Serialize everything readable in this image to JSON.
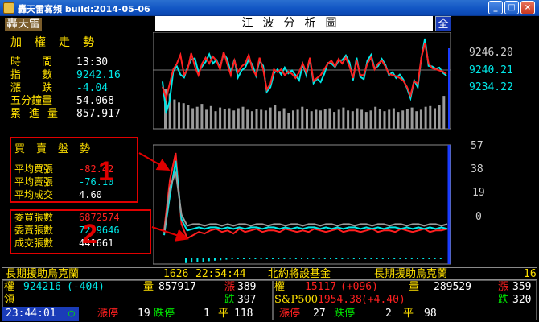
{
  "window": {
    "title": "轟天雷寫頻 build:2014-05-06",
    "btn_minimize": "_",
    "btn_maximize": "□",
    "btn_close": "×"
  },
  "header": {
    "brand": "轟天雷",
    "chart_title": "江波分析圖",
    "corner_button": "全"
  },
  "index_panel": {
    "heading": "加權走勢",
    "rows": [
      {
        "label": "時　　間",
        "value": "13:30",
        "color": "#ffffff"
      },
      {
        "label": "指　　數",
        "value": "9242.16",
        "color": "#00e8e8"
      },
      {
        "label": "漲　　跌",
        "value": "-4.04",
        "color": "#00e8e8"
      },
      {
        "label": "五分鐘量",
        "value": "54.068",
        "color": "#ffffff"
      },
      {
        "label": "累進量",
        "value": "857.917",
        "color": "#ffffff"
      }
    ]
  },
  "order_panel": {
    "heading": "買賣盤勢",
    "rows": [
      {
        "label": "平均買張",
        "value": "-82.42",
        "color": "#ff2020"
      },
      {
        "label": "平均賣張",
        "value": "-76.10",
        "color": "#00e8e8"
      },
      {
        "label": "平均成交",
        "value": "4.60",
        "color": "#ffffff"
      }
    ],
    "marker": "1"
  },
  "volume_panel": {
    "rows": [
      {
        "label": "委買張數",
        "value": "6872574",
        "color": "#ff2020"
      },
      {
        "label": "委賣張數",
        "value": "7229646",
        "color": "#00e8e8"
      },
      {
        "label": "成交張數",
        "value": "441661",
        "color": "#ffffff"
      }
    ],
    "marker": "2"
  },
  "price_axis": {
    "labels": [
      "9246.20",
      "9240.21",
      "9234.22"
    ]
  },
  "order_axis": {
    "labels": [
      "57",
      "38",
      "19",
      "0"
    ]
  },
  "ticker": {
    "items": [
      "長期援助烏克蘭",
      "1626",
      "22:54:44",
      "北約將設基金",
      "長期援助烏克蘭",
      "16"
    ]
  },
  "market_row1": {
    "left_label": "權",
    "left_value": "924216",
    "left_change": "(-404)",
    "vol_label": "量",
    "vol_value": "857917",
    "up_label": "漲",
    "up_value": "389",
    "fut_label": "權",
    "fut_value": "15117",
    "fut_change": "(+096)",
    "fut_vol_label": "量",
    "fut_vol_value": "289529",
    "fut_up_label": "漲",
    "fut_up_value": "359"
  },
  "market_row2": {
    "lead_label": "領",
    "down_label": "跌",
    "down_value": "397",
    "sp_label": "S&P500",
    "sp_value": "1954.38",
    "sp_change": "(+4.40)",
    "fut_down_label": "跌",
    "fut_down_value": "320"
  },
  "market_row3": {
    "clock": "23:44:01",
    "clock_mark": "○",
    "limit_up_label": "漲停",
    "limit_up_value": "19",
    "limit_down_label": "跌停",
    "limit_down_value": "1",
    "flat_label": "平",
    "flat_value": "118",
    "fut_limit_up_label": "漲停",
    "fut_limit_up_value": "27",
    "fut_limit_down_label": "跌停",
    "fut_limit_down_value": "2",
    "fut_flat_label": "平",
    "fut_flat_value": "98"
  },
  "chart_data": {
    "type": "line",
    "price": {
      "yaxis_labels": [
        9246.2,
        9240.21,
        9234.22
      ],
      "series": [
        {
          "color": "#00e8e8",
          "values": [
            9242.9,
            9237.5,
            9239.5,
            9244.7,
            9245.5,
            9244.1,
            9243.6,
            9245.4,
            9246.7,
            9246.9,
            9244.5,
            9245.5,
            9246.3,
            9247.6,
            9246.0,
            9246.6,
            9245.3,
            9247.7,
            9246.8,
            9244.4,
            9246.7,
            9243.6,
            9244.8,
            9245.3,
            9246.7,
            9245.8,
            9243.9,
            9246.5,
            9245.6,
            9241.1,
            9241.9,
            9244.3,
            9245.0,
            9244.1,
            9245.3,
            9244.3,
            9244.8,
            9244.0,
            9243.1,
            9245.9,
            9244.0,
            9246.9,
            9242.6,
            9243.4,
            9242.8,
            9244.2,
            9246.1,
            9246.0,
            9245.4,
            9246.5,
            9246.6,
            9247.4,
            9246.2,
            9243.1,
            9247.0,
            9243.7,
            9243.3,
            9246.5,
            9247.5,
            9245.1,
            9245.6,
            9246.8,
            9245.8,
            9244.0,
            9244.5,
            9243.5,
            9244.1,
            9243.2,
            9241.8,
            9240.0,
            9243.1,
            9241.9,
            9246.9,
            9250.3,
            9245.6,
            9245.5,
            9245.1,
            9245.3,
            9244.4,
            9243.9
          ]
        },
        {
          "color": "#ff2020",
          "values": [
            9242.0,
            9240.0,
            9242.5,
            9245.0,
            9246.0,
            9247.5,
            9244.0,
            9245.0,
            9247.8,
            9245.5,
            9244.0,
            9246.0,
            9247.0,
            9246.0,
            9247.2,
            9246.5,
            9245.0,
            9248.0,
            9246.0,
            9244.0,
            9246.5,
            9244.5,
            9245.5,
            9246.0,
            9247.5,
            9245.0,
            9244.0,
            9247.0,
            9245.0,
            9241.5,
            9242.5,
            9245.0,
            9244.5,
            9245.0,
            9244.0,
            9244.6,
            9244.2,
            9243.5,
            9244.5,
            9246.0,
            9244.5,
            9247.0,
            9243.0,
            9243.5,
            9244.0,
            9245.0,
            9246.0,
            9246.5,
            9245.5,
            9246.8,
            9246.0,
            9247.0,
            9245.5,
            9243.5,
            9246.5,
            9244.0,
            9244.0,
            9246.0,
            9247.0,
            9245.0,
            9246.0,
            9246.5,
            9245.5,
            9244.2,
            9244.0,
            9243.8,
            9243.5,
            9243.0,
            9242.0,
            9240.5,
            9243.0,
            9242.5,
            9247.0,
            9249.5,
            9246.0,
            9245.2,
            9245.0,
            9244.8,
            9244.6,
            9244.2
          ]
        }
      ],
      "volume_bars": [
        55,
        48,
        40,
        36,
        35,
        32,
        28,
        30,
        34,
        26,
        31,
        24,
        29,
        27,
        28,
        25,
        28,
        30,
        26,
        24,
        27,
        26,
        25,
        29,
        32,
        24,
        28,
        22,
        25,
        26,
        30,
        27,
        24,
        26,
        25,
        27,
        28,
        23,
        26,
        29,
        25,
        24,
        28,
        26,
        23,
        25,
        30,
        27,
        24,
        26,
        28,
        23,
        25,
        27,
        29,
        24,
        26,
        30,
        31,
        28,
        33,
        45
      ]
    },
    "orders": {
      "ylim": [
        0,
        57
      ],
      "yticks": [
        57,
        38,
        19,
        0
      ],
      "series": [
        {
          "color": "#ff2020",
          "values": [
            8,
            40,
            57,
            12,
            3,
            5,
            7,
            6,
            8,
            9,
            7,
            8,
            6,
            9,
            7,
            8,
            9,
            7,
            8,
            8,
            7,
            9,
            8,
            7,
            8,
            7,
            9,
            8,
            7,
            8,
            9,
            7,
            8,
            8,
            7,
            8,
            9,
            7,
            8,
            8,
            7,
            9,
            8,
            7,
            8,
            9,
            7,
            8,
            8,
            9
          ]
        },
        {
          "color": "#00e8e8",
          "values": [
            5,
            30,
            52,
            15,
            8,
            9,
            10,
            9,
            10,
            10,
            9,
            10,
            9,
            10,
            9,
            10,
            10,
            9,
            10,
            10,
            9,
            10,
            9,
            10,
            9,
            10,
            10,
            9,
            10,
            9,
            10,
            9,
            10,
            10,
            9,
            10,
            9,
            10,
            9,
            10,
            10,
            9,
            10,
            9,
            10,
            9,
            10,
            9,
            10,
            9
          ]
        },
        {
          "color": "#9a9a9a",
          "values": [
            6,
            35,
            45,
            18,
            11,
            12,
            12,
            11,
            12,
            12,
            11,
            12,
            11,
            12,
            12,
            11,
            12,
            12,
            11,
            12,
            12,
            11,
            12,
            12,
            11,
            12,
            12,
            11,
            12,
            12,
            11,
            12,
            12,
            11,
            12,
            12,
            11,
            12,
            12,
            11,
            12,
            12,
            11,
            12,
            12,
            11,
            12,
            12,
            11,
            12
          ]
        }
      ]
    }
  }
}
